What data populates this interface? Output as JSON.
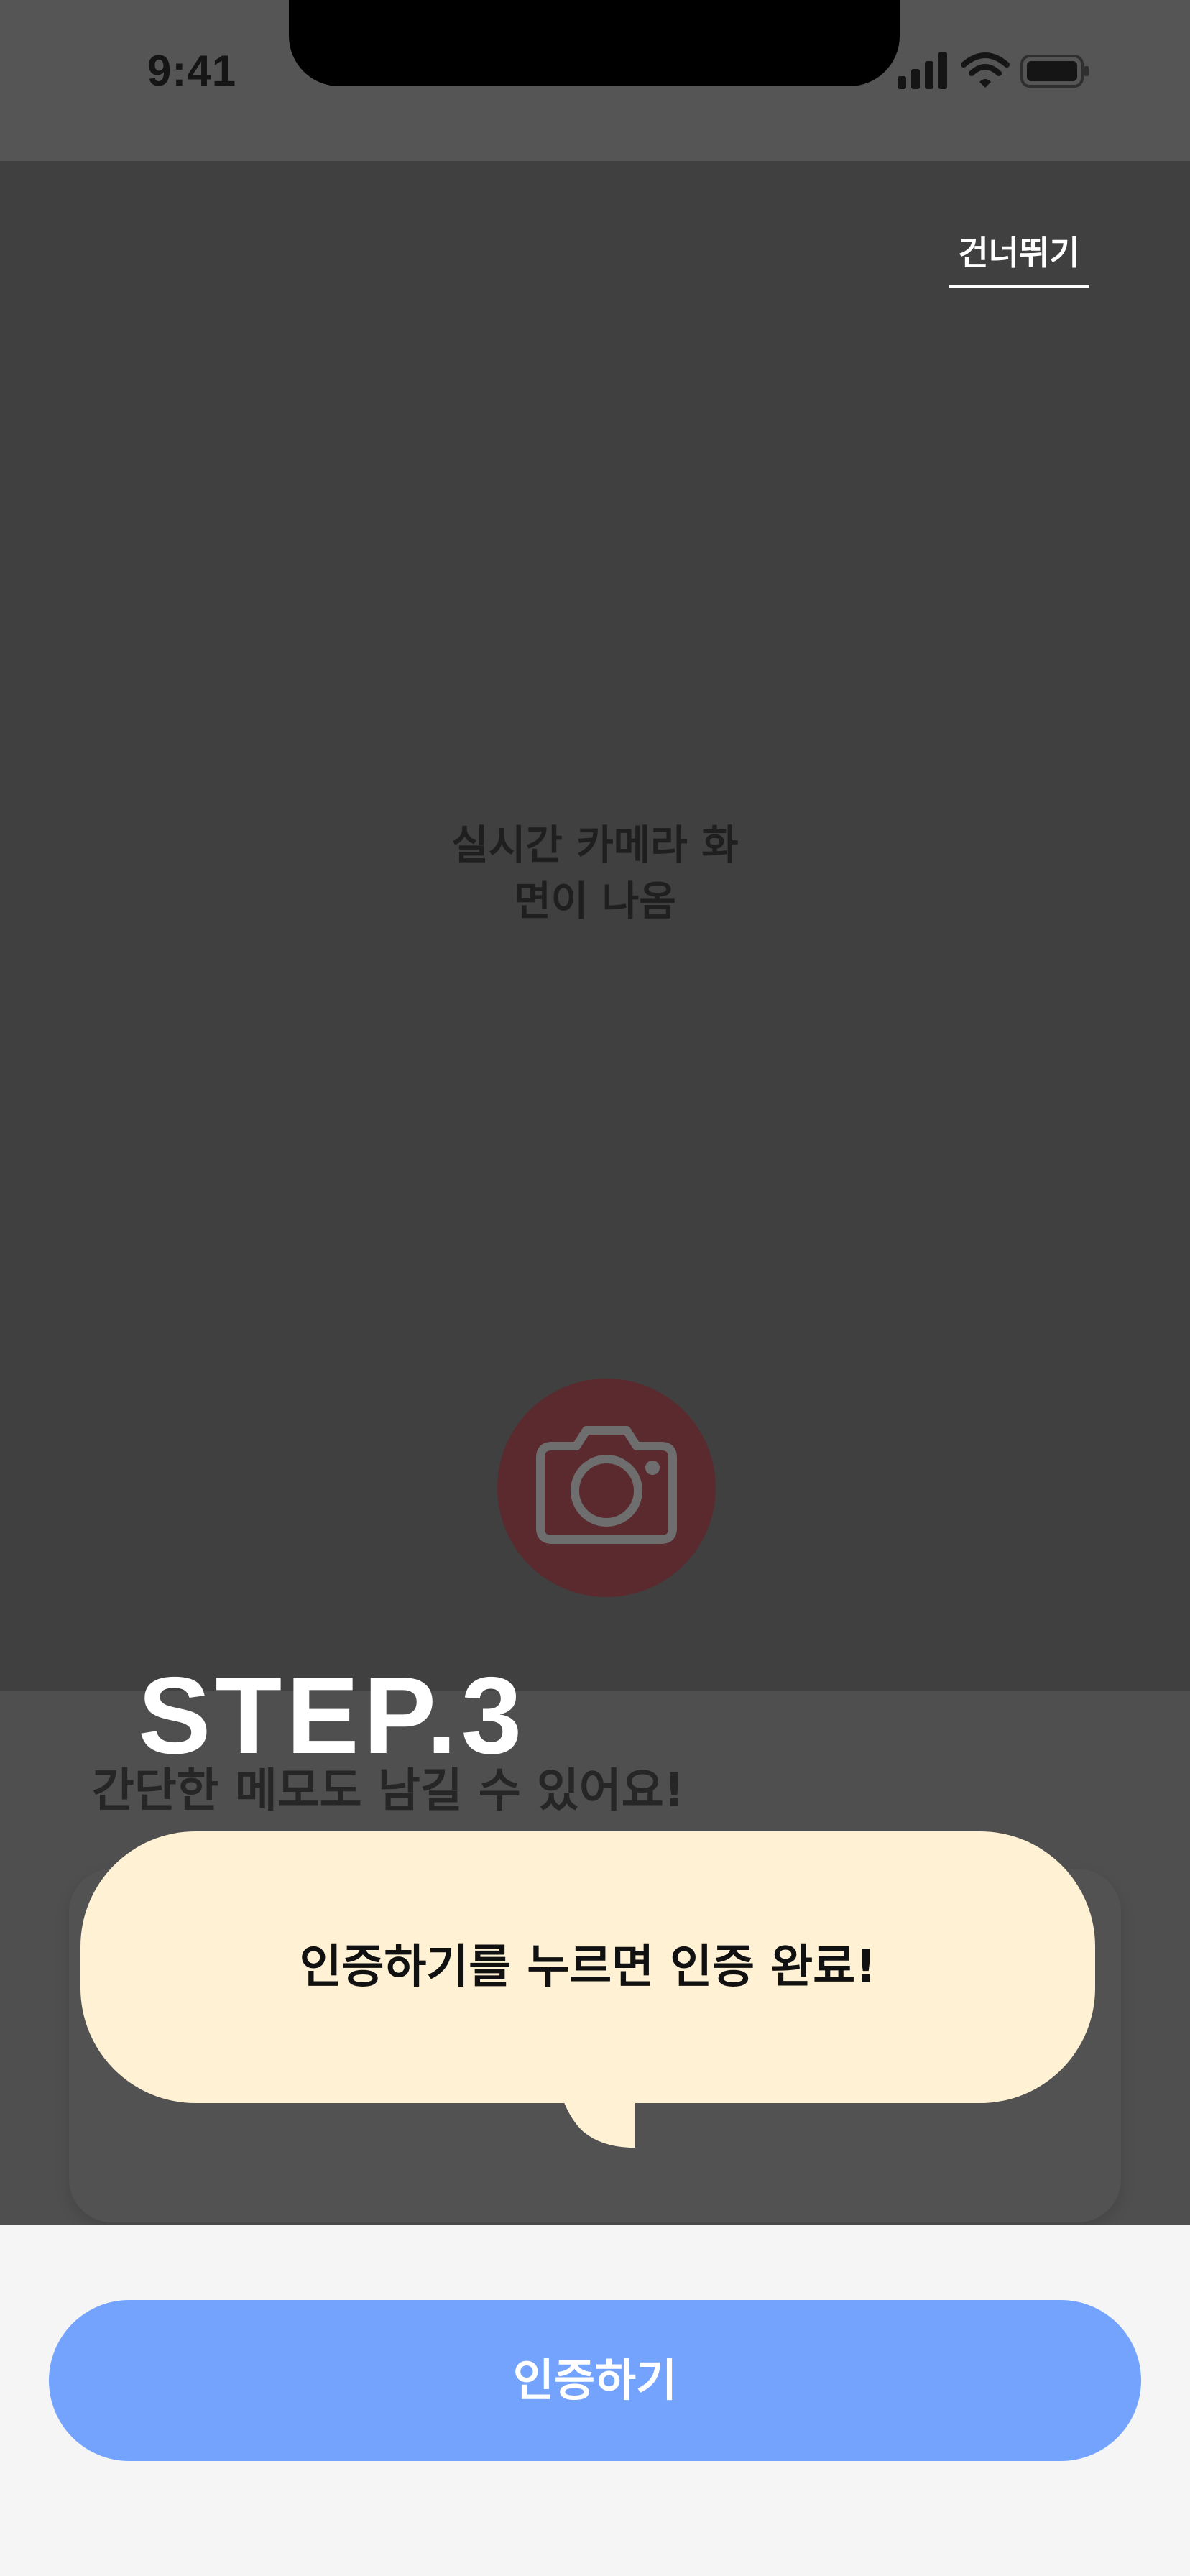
{
  "status_bar": {
    "time": "9:41",
    "icons": [
      "signal-icon",
      "wifi-icon",
      "battery-icon"
    ]
  },
  "header": {
    "skip_label": "건너뛰기"
  },
  "camera": {
    "hint_line1": "실시간 카메라 화",
    "hint_line2": "면이 나옴",
    "capture_icon": "camera-icon"
  },
  "onboarding": {
    "step_title": "STEP.3",
    "step_caption": "간단한 메모도 남길 수 있어요!",
    "bubble_text": "인증하기를 누르면 인증 완료!"
  },
  "footer": {
    "verify_label": "인증하기"
  },
  "colors": {
    "primary_button": "#74a3fd",
    "bubble_background": "#fff2d4",
    "capture_button": "#5a2a2e"
  }
}
